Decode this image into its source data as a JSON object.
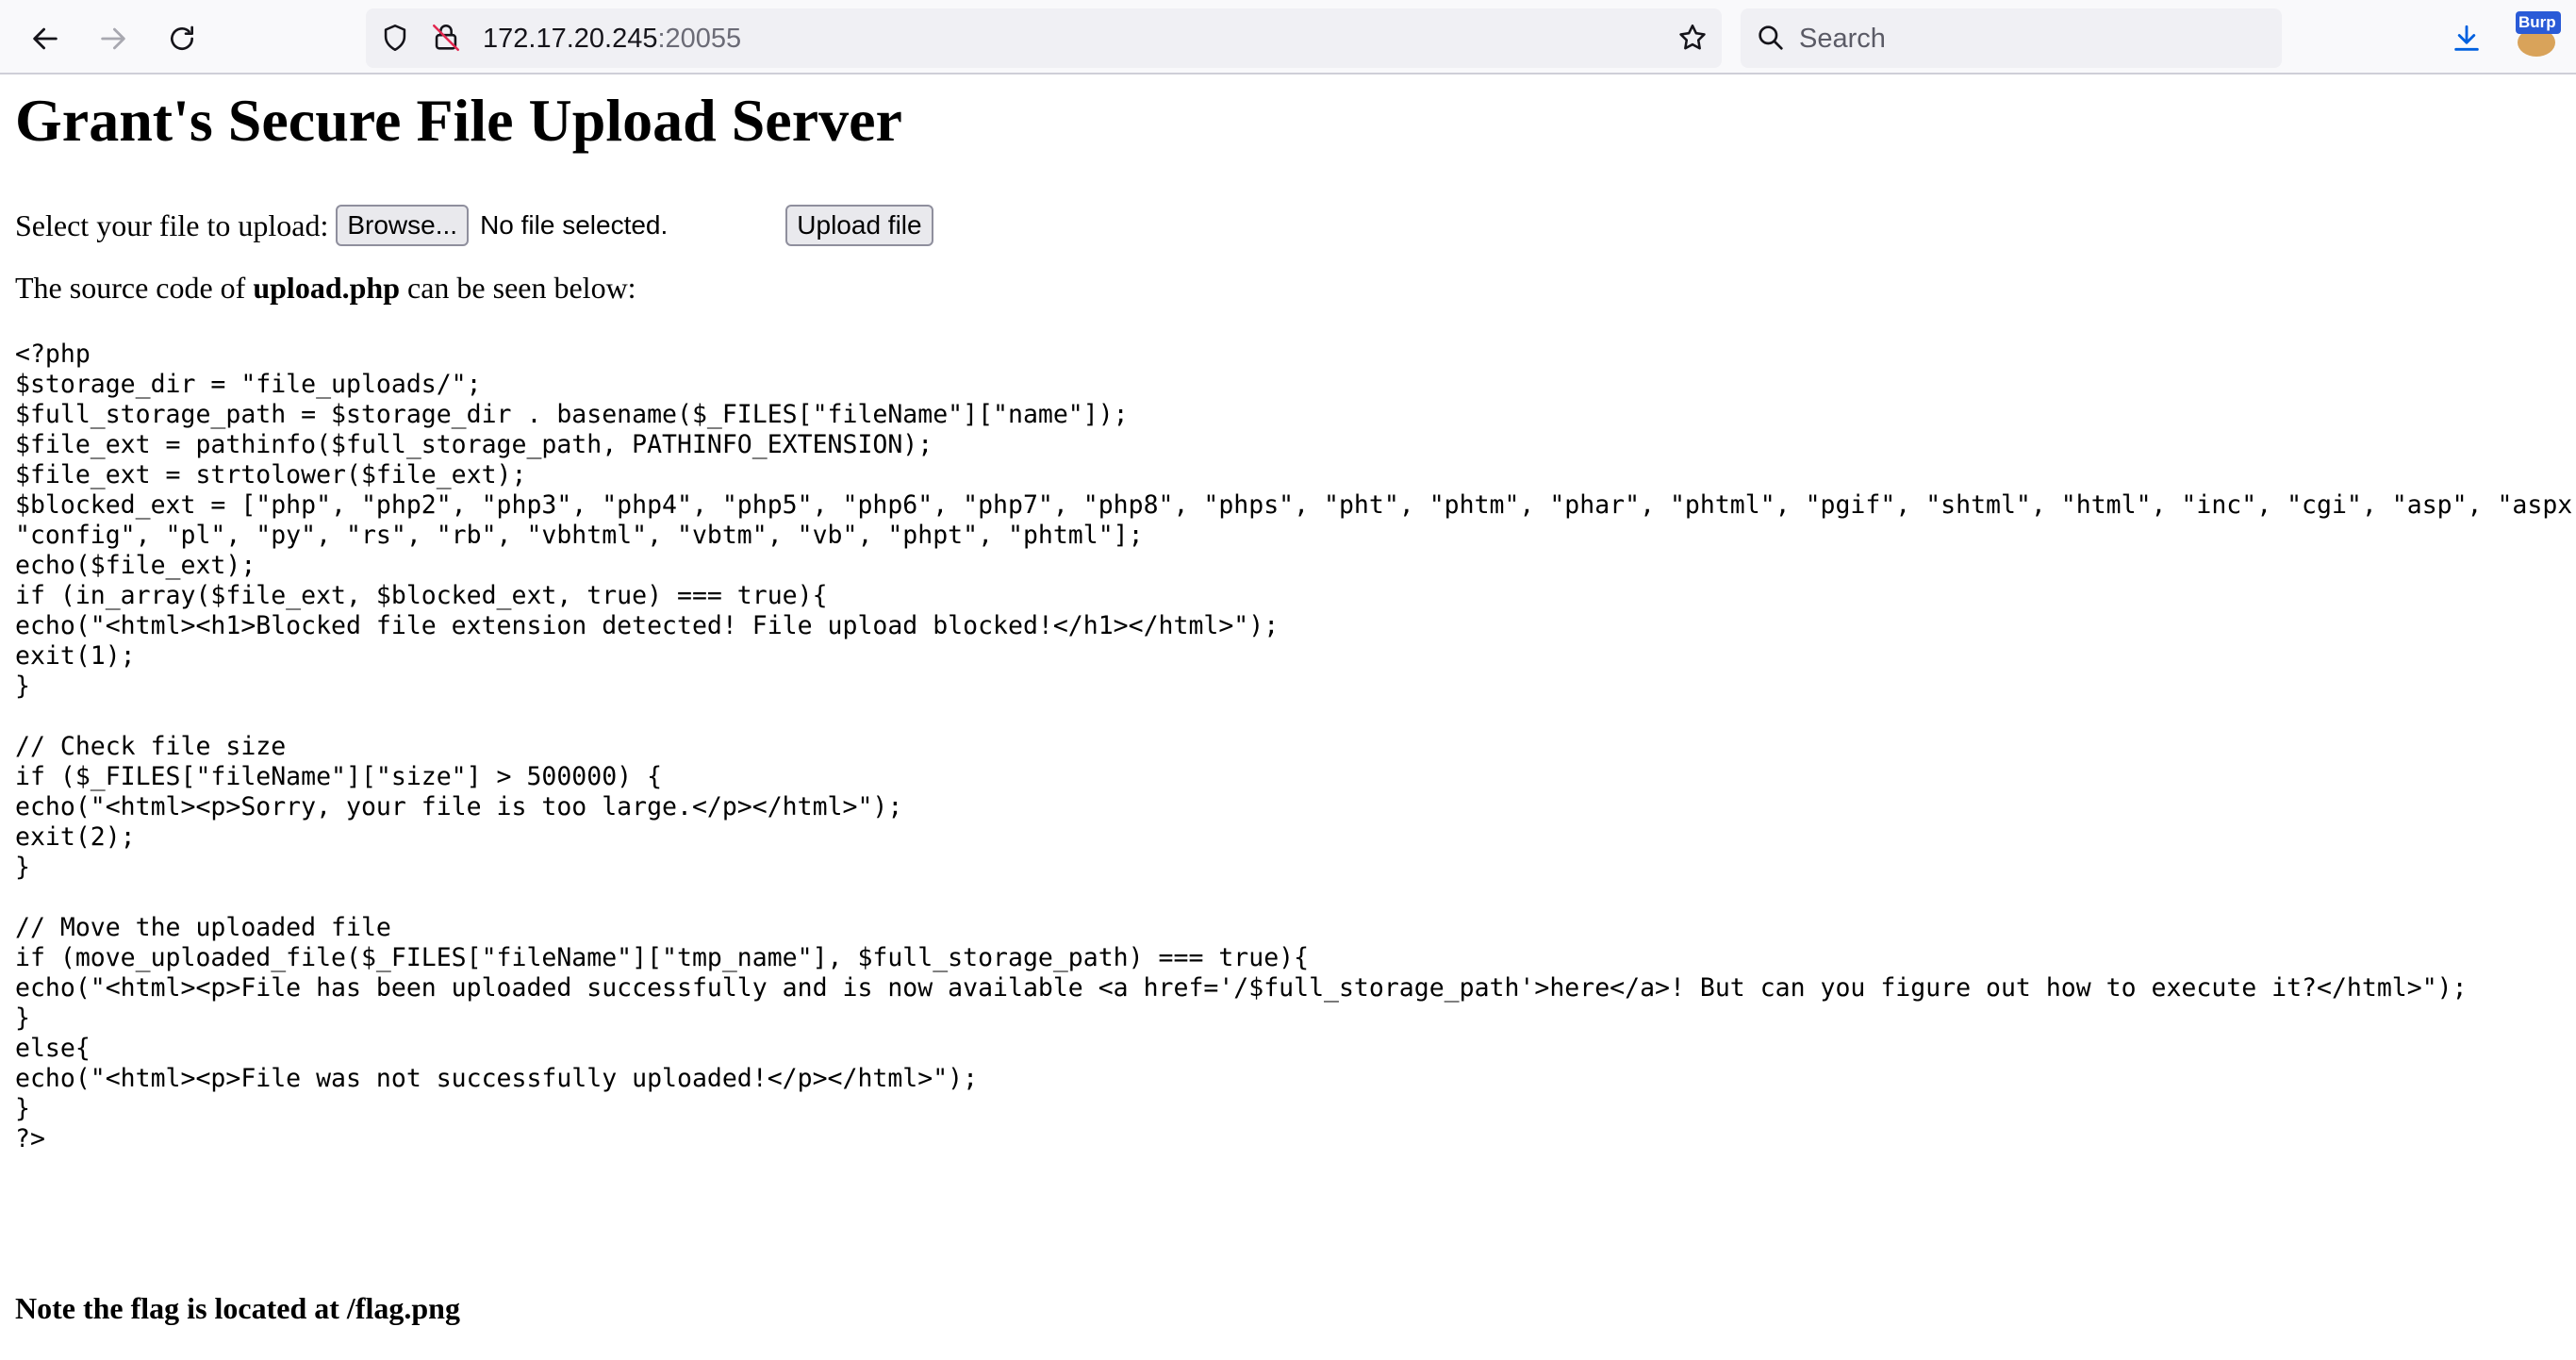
{
  "browser": {
    "url_host": "172.17.20.245",
    "url_port": ":20055",
    "search_placeholder": "Search",
    "extension_badge": "Burp",
    "icons": {
      "back": "arrow-left-icon",
      "forward": "arrow-right-icon",
      "reload": "reload-icon",
      "shield": "shield-icon",
      "insecure_lock": "insecure-lock-icon",
      "bookmark": "star-icon",
      "search": "search-icon",
      "downloads": "download-icon"
    },
    "accent_color": "#0060df"
  },
  "page": {
    "title": "Grant's Secure File Upload Server",
    "upload_prompt": "Select your file to upload:",
    "browse_label": "Browse...",
    "no_file_text": "No file selected.",
    "upload_button_label": "Upload file",
    "source_intro_before": "The source code of ",
    "source_intro_file": "upload.php",
    "source_intro_after": " can be seen below:",
    "source_code": "<?php\n$storage_dir = \"file_uploads/\";\n$full_storage_path = $storage_dir . basename($_FILES[\"fileName\"][\"name\"]);\n$file_ext = pathinfo($full_storage_path, PATHINFO_EXTENSION);\n$file_ext = strtolower($file_ext);\n$blocked_ext = [\"php\", \"php2\", \"php3\", \"php4\", \"php5\", \"php6\", \"php7\", \"php8\", \"phps\", \"pht\", \"phtm\", \"phar\", \"phtml\", \"pgif\", \"shtml\", \"html\", \"inc\", \"cgi\", \"asp\", \"aspx\",\n\"config\", \"pl\", \"py\", \"rs\", \"rb\", \"vbhtml\", \"vbtm\", \"vb\", \"phpt\", \"phtml\"];\necho($file_ext);\nif (in_array($file_ext, $blocked_ext, true) === true){\necho(\"<html><h1>Blocked file extension detected! File upload blocked!</h1></html>\");\nexit(1);\n}\n\n// Check file size\nif ($_FILES[\"fileName\"][\"size\"] > 500000) {\necho(\"<html><p>Sorry, your file is too large.</p></html>\");\nexit(2);\n}\n\n// Move the uploaded file\nif (move_uploaded_file($_FILES[\"fileName\"][\"tmp_name\"], $full_storage_path) === true){\necho(\"<html><p>File has been uploaded successfully and is now available <a href='/$full_storage_path'>here</a>! But can you figure out how to execute it?</html>\");\n}\nelse{\necho(\"<html><p>File was not successfully uploaded!</p></html>\");\n}\n?>",
    "flag_note": "Note the flag is located at /flag.png"
  }
}
